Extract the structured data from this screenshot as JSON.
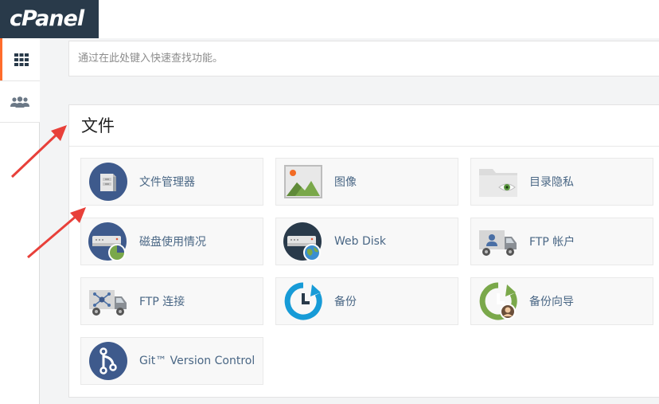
{
  "brand": {
    "logo_text": "cPanel"
  },
  "search": {
    "placeholder": "通过在此处键入快速查找功能。"
  },
  "files_section": {
    "title": "文件",
    "items": [
      {
        "label": "文件管理器",
        "icon": "file-manager-icon"
      },
      {
        "label": "图像",
        "icon": "images-icon"
      },
      {
        "label": "目录隐私",
        "icon": "directory-privacy-icon"
      },
      {
        "label": "磁盘使用情况",
        "icon": "disk-usage-icon"
      },
      {
        "label": "Web Disk",
        "icon": "web-disk-icon"
      },
      {
        "label": "FTP 帐户",
        "icon": "ftp-accounts-icon"
      },
      {
        "label": "FTP 连接",
        "icon": "ftp-connections-icon"
      },
      {
        "label": "备份",
        "icon": "backup-icon"
      },
      {
        "label": "备份向导",
        "icon": "backup-wizard-icon"
      },
      {
        "label": "Git™ Version Control",
        "icon": "git-version-control-icon"
      }
    ]
  },
  "sidebar": {
    "items": [
      {
        "icon": "grid-icon",
        "active": true
      },
      {
        "icon": "users-icon",
        "active": false
      }
    ]
  },
  "colors": {
    "brand_dark": "#293a4a",
    "accent": "#ff6c2c",
    "link": "#4a6785",
    "annotation": "#e8403a"
  }
}
